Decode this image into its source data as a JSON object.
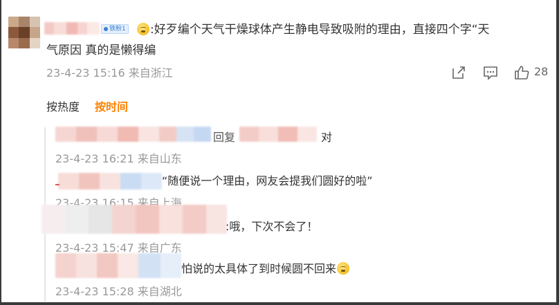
{
  "comment": {
    "badge_text": "铁粉1",
    "text_line1": ":好歹编个天气干燥球体产生静电导致吸附的理由，直接四个字“天",
    "text_line2": "气原因 真的是懒得编",
    "timestamp": "23-4-23 15:16",
    "location": "来自浙江",
    "like_count": "28"
  },
  "sort": {
    "by_heat": "按热度",
    "by_time": "按时间"
  },
  "replies": [
    {
      "reply_word": "回复",
      "text": "对",
      "timestamp": "23-4-23 16:21",
      "location": "来自山东"
    },
    {
      "text": "“随便说一个理由，网友会提我们圆好的啦”",
      "timestamp": "23-4-23 16:15",
      "location": "来自上海"
    },
    {
      "text": ":哦，下次不会了！",
      "timestamp": "23-4-23 15:47",
      "location": "来自广东"
    },
    {
      "text": "怕说的太具体了到时候圆不回来",
      "timestamp": "23-4-23 15:28",
      "location": "来自湖北"
    }
  ],
  "icons": [
    "share-icon",
    "comment-icon",
    "like-icon",
    "tired-face-emoji-icon",
    "crying-emoji-icon"
  ],
  "colors": {
    "accent_orange": "#ff8200",
    "meta_gray": "#999999",
    "text": "#333333",
    "badge_blue": "#3c7fd0"
  }
}
